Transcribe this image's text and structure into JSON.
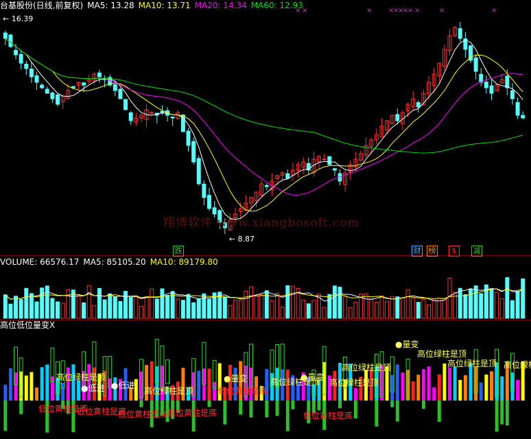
{
  "price_panel": {
    "title": "台基股份(日线,前复权)",
    "ma5_label": "MA5: 13.28",
    "ma10_label": "MA10: 13.71",
    "ma20_label": "MA20: 14.34",
    "ma60_label": "MA60: 12.93",
    "high_marker": "16.39",
    "low_marker": "8.87",
    "watermark": "翔博软件 www.xiangbosoft.com",
    "events": [
      {
        "label": "跌",
        "color": "#3cc03c"
      },
      {
        "label": "财",
        "color": "#4aa8ff"
      },
      {
        "label": "榜",
        "color": "#ff8000"
      },
      {
        "label": "$",
        "color": "#ff3030"
      },
      {
        "label": "减",
        "color": "#3cc03c"
      }
    ]
  },
  "volume_panel": {
    "label": "VOLUME: 66576.17",
    "ma5_label": "MA5: 85105.20",
    "ma10_label": "MA10: 89179.80"
  },
  "indicator_panel": {
    "title": "高位低位量变X",
    "labels": {
      "top": "高位绿柱是顶",
      "bottom": "低位黄柱是底",
      "change": "●量变",
      "low_entry": "●低进"
    }
  },
  "colors": {
    "up": "#ff3232",
    "down": "#54fcfc",
    "ma5": "#ffffff",
    "ma10": "#ffff00",
    "ma20": "#ff00ff",
    "ma60": "#00e000",
    "frame": "#7a0000"
  },
  "chart_data": {
    "type": "candlestick",
    "price_closes": [
      15.8,
      15.5,
      15.2,
      14.9,
      14.7,
      14.4,
      14.2,
      14.0,
      13.8,
      13.6,
      13.4,
      13.7,
      13.9,
      14.0,
      14.2,
      14.1,
      14.3,
      14.5,
      14.4,
      14.3,
      14.1,
      13.9,
      13.6,
      13.2,
      12.8,
      12.9,
      13.0,
      13.2,
      13.1,
      13.0,
      13.1,
      13.0,
      12.9,
      13.1,
      12.4,
      11.9,
      11.3,
      10.5,
      10.0,
      9.6,
      9.4,
      9.1,
      8.9,
      9.2,
      9.4,
      9.6,
      9.8,
      10.0,
      10.2,
      10.5,
      10.4,
      10.6,
      10.8,
      10.9,
      10.7,
      11.0,
      11.2,
      11.3,
      11.0,
      11.4,
      11.5,
      11.4,
      11.2,
      11.0,
      10.6,
      10.9,
      11.2,
      11.4,
      11.6,
      11.9,
      12.1,
      12.3,
      12.6,
      12.8,
      13.0,
      12.8,
      13.1,
      13.4,
      13.6,
      13.3,
      13.8,
      14.2,
      14.5,
      14.9,
      15.4,
      15.9,
      16.2,
      15.8,
      15.4,
      15.0,
      14.6,
      14.2,
      14.0,
      13.8,
      14.1,
      14.3,
      14.0,
      13.6,
      13.0,
      12.9
    ],
    "price_high": 16.39,
    "price_low": 8.87,
    "volume_latest": 66576.17,
    "volume_ma5": 85105.2,
    "volume_ma10": 89179.8
  }
}
